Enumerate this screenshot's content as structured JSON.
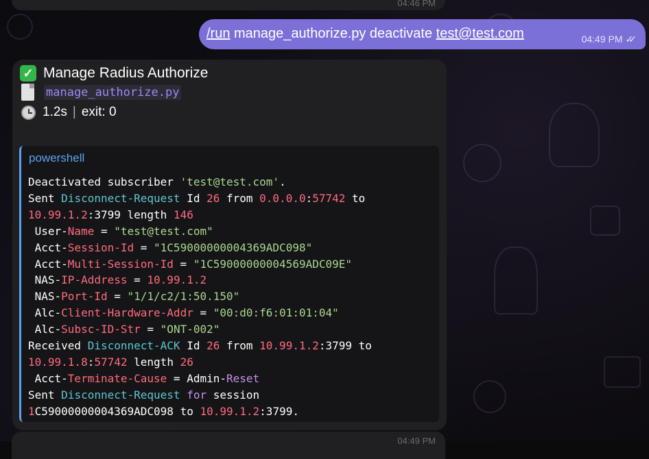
{
  "chat": {
    "prev_message_time": "04:46 PM",
    "next_message_time": "04:49 PM",
    "outgoing": {
      "command": "/run",
      "text_middle": " manage_authorize.py deactivate ",
      "email": "test@test.com",
      "time": "04:49 PM",
      "status": "read"
    },
    "incoming": {
      "title": "Manage Radius Authorize",
      "file": "manage_authorize.py",
      "duration": "1.2s",
      "separator": "|",
      "exit": "exit: 0",
      "code_language": "powershell",
      "code_lines": [
        [
          {
            "t": "plain",
            "v": "Deactivated subscriber "
          },
          {
            "t": "str",
            "v": "'test@test.com'"
          },
          {
            "t": "plain",
            "v": "."
          }
        ],
        [
          {
            "t": "plain",
            "v": "Sent "
          },
          {
            "t": "type",
            "v": "Disconnect-Request"
          },
          {
            "t": "plain",
            "v": " Id "
          },
          {
            "t": "num",
            "v": "26"
          },
          {
            "t": "plain",
            "v": " from "
          },
          {
            "t": "num",
            "v": "0.0.0.0"
          },
          {
            "t": "plain",
            "v": ":"
          },
          {
            "t": "num",
            "v": "57742"
          },
          {
            "t": "plain",
            "v": " to"
          }
        ],
        [
          {
            "t": "num",
            "v": "10.99.1.2"
          },
          {
            "t": "plain",
            "v": ":3799 length "
          },
          {
            "t": "num",
            "v": "146"
          }
        ],
        [
          {
            "t": "plain",
            "v": " User-"
          },
          {
            "t": "num",
            "v": "Name"
          },
          {
            "t": "plain",
            "v": " = "
          },
          {
            "t": "str",
            "v": "\"test@test.com\""
          }
        ],
        [
          {
            "t": "plain",
            "v": " Acct-"
          },
          {
            "t": "num",
            "v": "Session-Id"
          },
          {
            "t": "plain",
            "v": " = "
          },
          {
            "t": "str",
            "v": "\"1C59000000004369ADC098\""
          }
        ],
        [
          {
            "t": "plain",
            "v": " Acct-"
          },
          {
            "t": "num",
            "v": "Multi-Session-Id"
          },
          {
            "t": "plain",
            "v": " = "
          },
          {
            "t": "str",
            "v": "\"1C59000000004569ADC09E\""
          }
        ],
        [
          {
            "t": "plain",
            "v": " NAS-"
          },
          {
            "t": "num",
            "v": "IP-Address"
          },
          {
            "t": "plain",
            "v": " = "
          },
          {
            "t": "num",
            "v": "10.99.1.2"
          }
        ],
        [
          {
            "t": "plain",
            "v": " NAS-"
          },
          {
            "t": "num",
            "v": "Port-Id"
          },
          {
            "t": "plain",
            "v": " = "
          },
          {
            "t": "str",
            "v": "\"1/1/c2/1:50.150\""
          }
        ],
        [
          {
            "t": "plain",
            "v": " Alc-"
          },
          {
            "t": "num",
            "v": "Client-Hardware-Addr"
          },
          {
            "t": "plain",
            "v": " = "
          },
          {
            "t": "str",
            "v": "\"00:d0:f6:01:01:04\""
          }
        ],
        [
          {
            "t": "plain",
            "v": " Alc-"
          },
          {
            "t": "num",
            "v": "Subsc-ID-Str"
          },
          {
            "t": "plain",
            "v": " = "
          },
          {
            "t": "str",
            "v": "\"ONT-002\""
          }
        ],
        [
          {
            "t": "plain",
            "v": "Received "
          },
          {
            "t": "type",
            "v": "Disconnect-ACK"
          },
          {
            "t": "plain",
            "v": " Id "
          },
          {
            "t": "num",
            "v": "26"
          },
          {
            "t": "plain",
            "v": " from "
          },
          {
            "t": "num",
            "v": "10.99.1.2"
          },
          {
            "t": "plain",
            "v": ":3799 to"
          }
        ],
        [
          {
            "t": "num",
            "v": "10.99.1.8"
          },
          {
            "t": "plain",
            "v": ":"
          },
          {
            "t": "num",
            "v": "57742"
          },
          {
            "t": "plain",
            "v": " length "
          },
          {
            "t": "num",
            "v": "26"
          }
        ],
        [
          {
            "t": "plain",
            "v": " Acct-"
          },
          {
            "t": "num",
            "v": "Terminate-Cause"
          },
          {
            "t": "plain",
            "v": " = Admin-"
          },
          {
            "t": "kw",
            "v": "Reset"
          }
        ],
        [
          {
            "t": "plain",
            "v": "Sent "
          },
          {
            "t": "type",
            "v": "Disconnect-Request"
          },
          {
            "t": "plain",
            "v": " "
          },
          {
            "t": "kw",
            "v": "for"
          },
          {
            "t": "plain",
            "v": " session"
          }
        ],
        [
          {
            "t": "num",
            "v": "1"
          },
          {
            "t": "plain",
            "v": "C59000000004369ADC098 to "
          },
          {
            "t": "num",
            "v": "10.99.1.2"
          },
          {
            "t": "plain",
            "v": ":3799."
          }
        ]
      ]
    }
  },
  "colors": {
    "outgoing_bubble": "#7b70d7",
    "incoming_bubble": "#202022",
    "code_background": "#151517",
    "code_accent": "#5aa3f0",
    "check_green": "#33b64a"
  },
  "icons": {
    "title": "check-mark-icon",
    "file": "page-file-icon",
    "duration": "stopwatch-icon",
    "status": "double-check-icon"
  }
}
